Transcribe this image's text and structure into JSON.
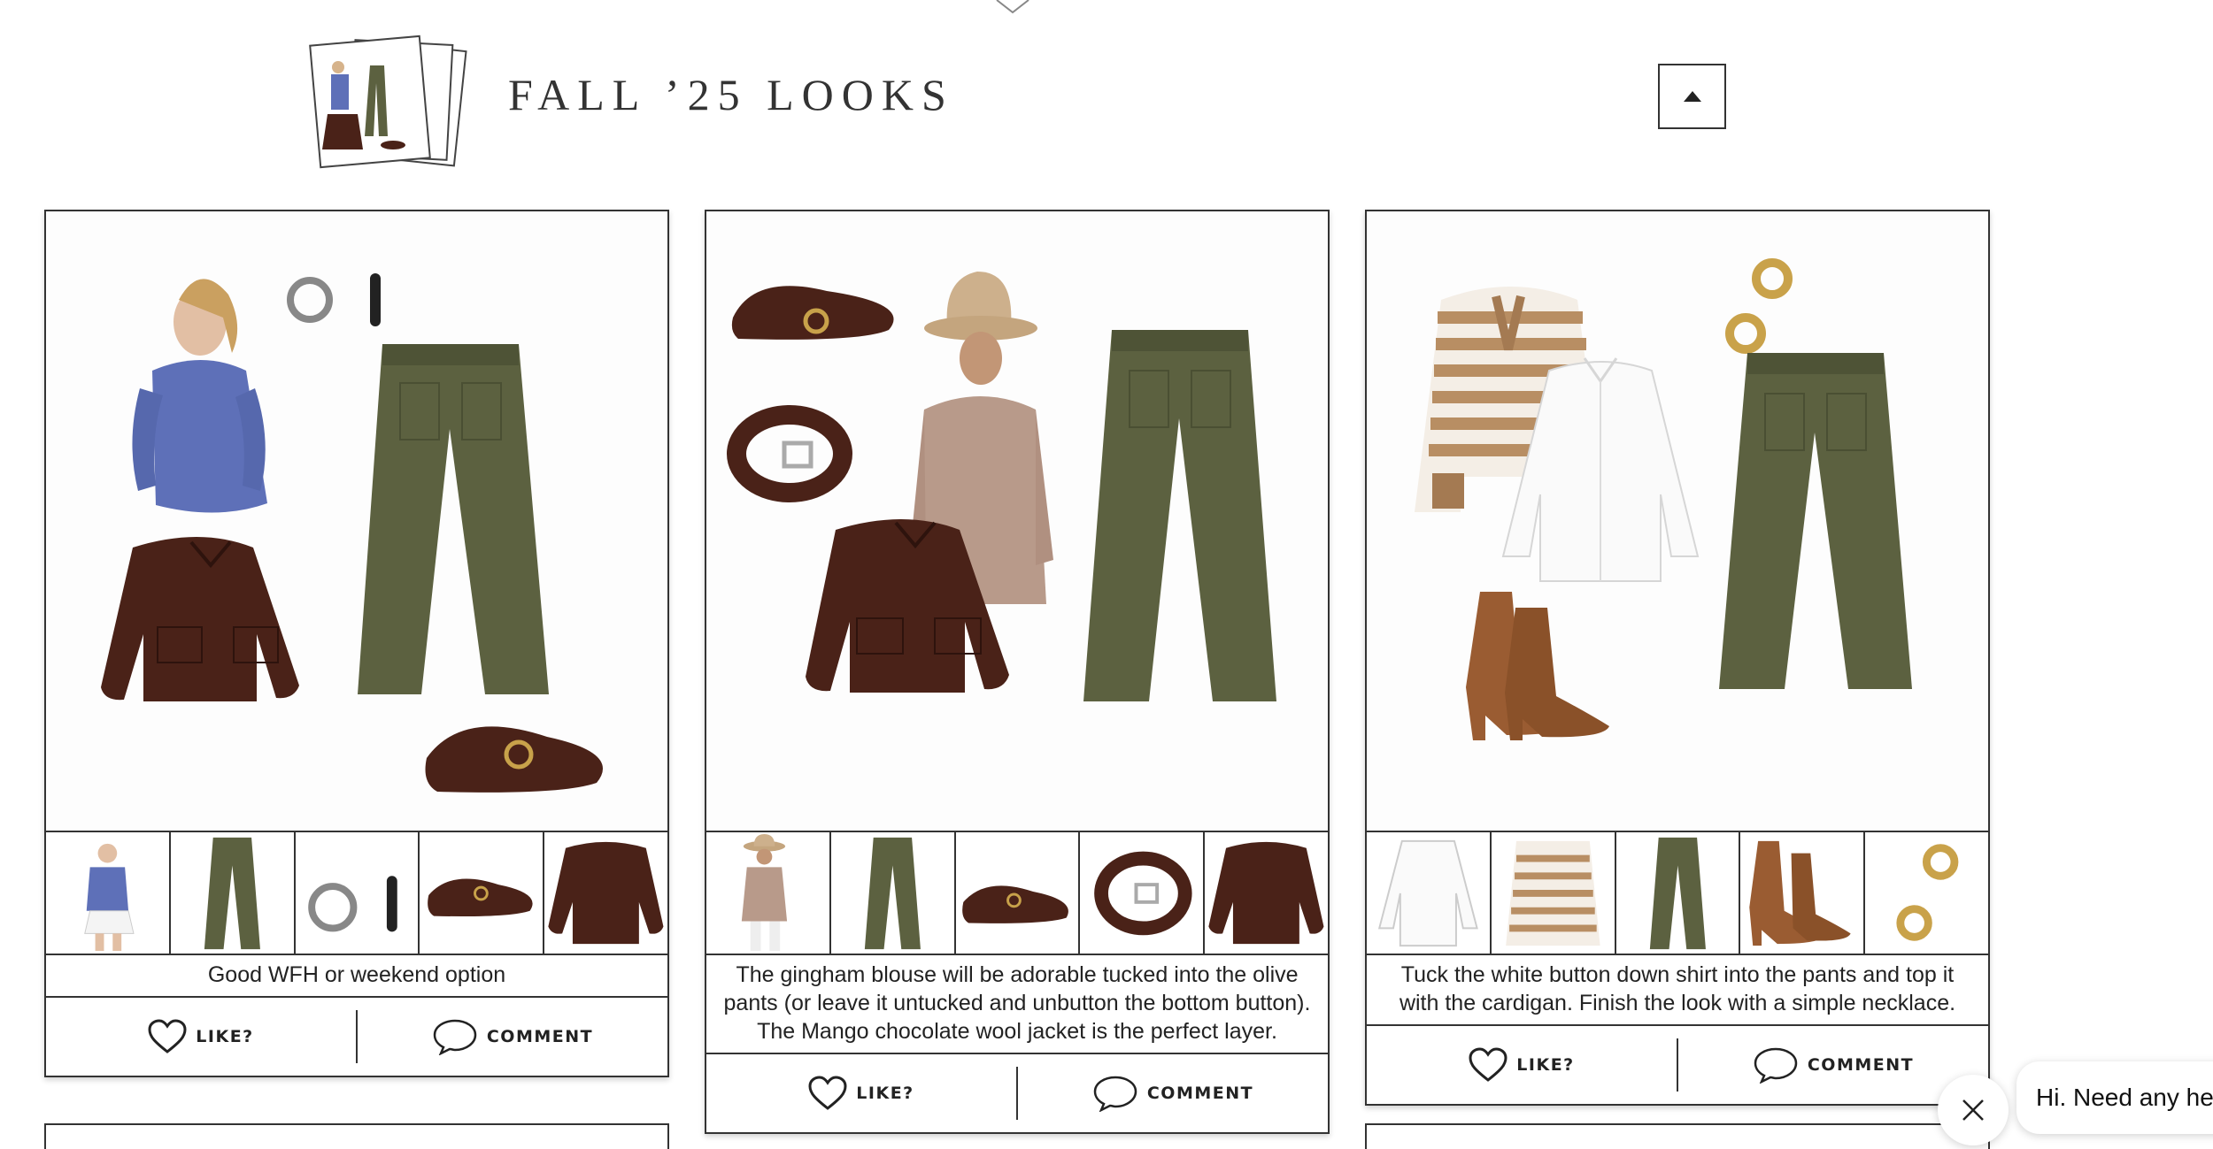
{
  "header": {
    "title": "FALL ’25 LOOKS",
    "collapse_icon": "caret-up-icon"
  },
  "looks": [
    {
      "caption": "Good WFH or weekend option",
      "like_label": "LIKE?",
      "comment_label": "COMMENT",
      "thumbnails": [
        "blue-sweater-outfit",
        "olive-wide-leg-pants",
        "silver-hoop-earrings",
        "brown-mary-jane-flats",
        "chocolate-wool-jacket"
      ]
    },
    {
      "caption": "The gingham blouse will be adorable tucked into the olive pants (or leave it untucked and unbutton the bottom button). The Mango chocolate wool jacket is the perfect layer.",
      "like_label": "LIKE?",
      "comment_label": "COMMENT",
      "thumbnails": [
        "gingham-blouse-bucket-hat",
        "olive-wide-leg-pants",
        "brown-mary-jane-flats",
        "brown-leather-belt",
        "chocolate-wool-jacket"
      ]
    },
    {
      "caption": "Tuck the white button down shirt into the pants and top it with the cardigan. Finish the look with a simple necklace.",
      "like_label": "LIKE?",
      "comment_label": "COMMENT",
      "thumbnails": [
        "white-button-down-shirt",
        "striped-cardigan",
        "olive-wide-leg-pants",
        "suede-ankle-boots",
        "gold-earrings"
      ]
    }
  ],
  "chat": {
    "message": "Hi. Need any he"
  },
  "colors": {
    "olive": "#5c6140",
    "chocolate": "#4a2218",
    "periwinkle": "#5e70b8",
    "tan": "#b88e63",
    "suede": "#9a5c32",
    "border": "#333333"
  }
}
